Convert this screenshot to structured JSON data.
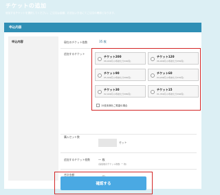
{
  "page": {
    "title": "チケットの追加",
    "description": "追加するチケットを選択してください。ご注文は金額、お支払い方法にてご注文の確認となります。"
  },
  "card": {
    "header": "申込内容",
    "section_label": "申込内容",
    "current_tickets_label": "現在のチケット枚数",
    "current_tickets_value": "35 枚",
    "add_ticket_label": "追加するチケット",
    "options": [
      {
        "name": "チケット200",
        "price": "¥8,000円 (1件あたり¥40円)"
      },
      {
        "name": "チケット120",
        "price": "¥6,000円 (1件あたり¥50円)"
      },
      {
        "name": "チケット90",
        "price": "¥5,400円 (1件あたり¥60円)"
      },
      {
        "name": "チケット60",
        "price": "¥4,200円 (1件あたり¥70円)"
      },
      {
        "name": "チケット30",
        "price": "¥2,400円 (1件あたり¥80円)"
      },
      {
        "name": "チケット15",
        "price": "¥1,350円 (1件あたり¥90円)"
      }
    ],
    "checkbox_label": "15枚未満をご希望の場合",
    "set_count_label": "購入セット数",
    "set_unit": "セット",
    "add_count_label": "追加するチケット枚数",
    "add_count_value": "一 枚",
    "add_count_sub": "(追加後のチケット枚数: 一 枚)",
    "total_label": "合計金額",
    "total_value": "一 円"
  },
  "confirm_button": "確認する"
}
